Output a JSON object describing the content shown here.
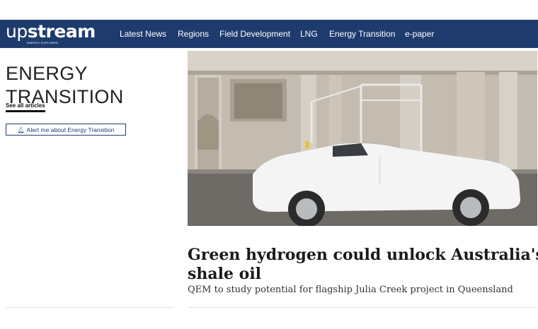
{
  "brand": {
    "name_light": "up",
    "name_bold": "stream",
    "tagline": "ENERGY EXPLORED"
  },
  "nav": {
    "items": [
      "Latest News",
      "Regions",
      "Field Development",
      "LNG",
      "Energy Transition",
      "e-paper"
    ]
  },
  "section": {
    "title_line1": "ENERGY",
    "title_line2": "TRANSITION",
    "see_all": "See all articles",
    "alert_label": "Alert me about Energy Transition"
  },
  "article": {
    "headline_line1": "Green hydrogen could unlock Australia's",
    "headline_line2": "shale oil",
    "standfirst": "QEM to study potential for flagship Julia Creek project in Queensland"
  },
  "colors": {
    "nav_bg": "#1f3b6e",
    "text": "#1a1a1a",
    "divider": "#dddddd"
  },
  "icons": {
    "alert": "bell-icon"
  }
}
